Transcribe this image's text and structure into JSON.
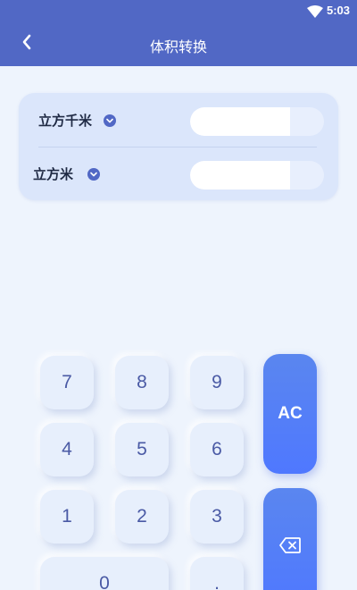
{
  "status_bar": {
    "time": "5:03",
    "wifi_icon": "wifi-icon"
  },
  "app_bar": {
    "title": "体积转换",
    "back_icon": "chevron-left-icon"
  },
  "converter": {
    "from": {
      "unit": "立方千米",
      "value": "",
      "dropdown_icon": "chevron-down-icon"
    },
    "to": {
      "unit": "立方米",
      "value": "",
      "dropdown_icon": "chevron-down-icon"
    }
  },
  "keypad": {
    "keys": [
      "7",
      "8",
      "9",
      "4",
      "5",
      "6",
      "1",
      "2",
      "3",
      "0",
      "."
    ],
    "clear_label": "AC",
    "backspace_icon": "backspace-icon"
  },
  "colors": {
    "primary": "#5168c5",
    "background": "#eef4fd",
    "card": "#dbe6fb",
    "key": "#e7effc",
    "key_text": "#4a5aa5",
    "action": "#4f78ff"
  }
}
